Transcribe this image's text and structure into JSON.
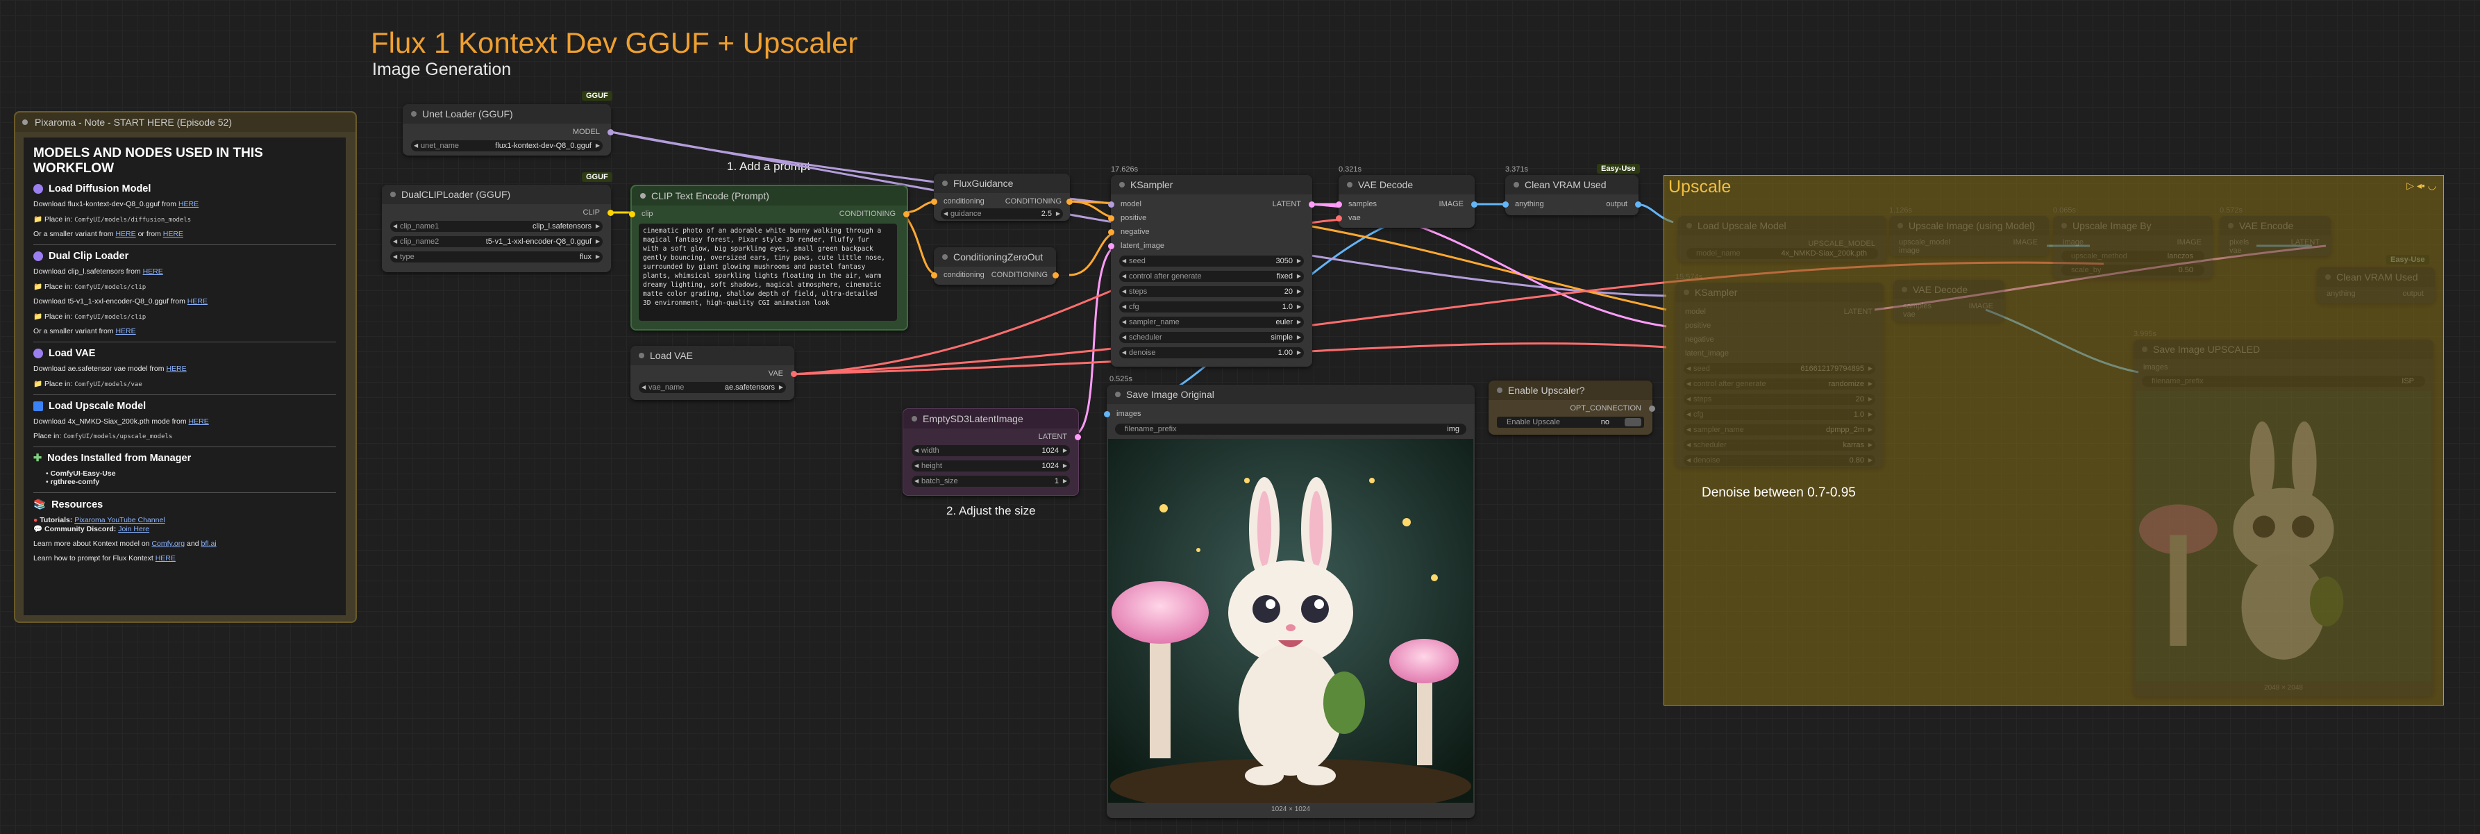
{
  "header": {
    "title": "Flux 1 Kontext Dev GGUF + Upscaler",
    "subtitle": "Image Generation"
  },
  "labels": {
    "step1": "1. Add a prompt",
    "step2": "2. Adjust the size",
    "denoise_tip": "Denoise between 0.7-0.95"
  },
  "note": {
    "title": "Pixaroma - Note - START HERE (Episode 52)",
    "heading": "MODELS AND NODES USED IN THIS WORKFLOW",
    "sec1_title": "Load Diffusion Model",
    "sec1_dl_prefix": "Download flux1-kontext-dev-Q8_0.gguf from",
    "sec1_place_prefix": "Place in:",
    "sec1_place_path": "ComfyUI/models/diffusion_models",
    "sec1_alt_prefix": "Or a smaller variant from",
    "sec1_alt_mid": "or from",
    "sec2_title": "Dual Clip Loader",
    "sec2_dl1_prefix": "Download clip_l.safetensors from",
    "sec2_place_prefix": "Place in:",
    "sec2_place_path": "ComfyUI/models/clip",
    "sec2_dl2_prefix": "Download t5-v1_1-xxl-encoder-Q8_0.gguf from",
    "sec2_place2_prefix": "Place in:",
    "sec2_place2_path": "ComfyUI/models/clip",
    "sec2_alt_prefix": "Or a smaller variant from",
    "sec3_title": "Load VAE",
    "sec3_dl_prefix": "Download ae.safetensor vae model from",
    "sec3_place_prefix": "Place in:",
    "sec3_place_path": "ComfyUI/models/vae",
    "sec4_title": "Load Upscale Model",
    "sec4_dl_prefix": "Download 4x_NMKD-Siax_200k.pth mode from",
    "sec4_place_prefix": "Place in:",
    "sec4_place_path": "ComfyUI/models/upscale_models",
    "sec5_title": "Nodes Installed from Manager",
    "sec5_item1": "ComfyUI-Easy-Use",
    "sec5_item2": "rgthree-comfy",
    "sec6_title": "Resources",
    "res_tutorials_prefix": "Tutorials:",
    "res_tutorials_link": "Pixaroma YouTube Channel",
    "res_discord_prefix": "Community Discord:",
    "res_discord_link": "Join Here",
    "res_learn_prefix": "Learn more about Kontext model on",
    "res_learn_link1": "Comfy.org",
    "res_learn_and": "and",
    "res_learn_link2": "bfl.ai",
    "res_prompt_prefix": "Learn how to prompt for Flux Kontext",
    "link_here": "HERE"
  },
  "nodes": {
    "unet": {
      "badge": "GGUF",
      "title": "Unet Loader (GGUF)",
      "out": "MODEL",
      "w_label": "unet_name",
      "w_value": "flux1-kontext-dev-Q8_0.gguf"
    },
    "dualclip": {
      "badge": "GGUF",
      "title": "DualCLIPLoader (GGUF)",
      "out": "CLIP",
      "w1_label": "clip_name1",
      "w1_value": "clip_l.safetensors",
      "w2_label": "clip_name2",
      "w2_value": "t5-v1_1-xxl-encoder-Q8_0.gguf",
      "w3_label": "type",
      "w3_value": "flux"
    },
    "clip_text": {
      "title": "CLIP Text Encode (Prompt)",
      "in": "clip",
      "out": "CONDITIONING",
      "prompt": "cinematic photo of an adorable white bunny walking through a magical fantasy forest, Pixar style 3D render, fluffy fur with a soft glow, big sparkling eyes, small green backpack gently bouncing, oversized ears, tiny paws, cute little nose, surrounded by giant glowing mushrooms and pastel fantasy plants, whimsical sparkling lights floating in the air, warm dreamy lighting, soft shadows, magical atmosphere, cinematic matte color grading, shallow depth of field, ultra-detailed 3D environment, high-quality CGI animation look"
    },
    "flux_guidance": {
      "title": "FluxGuidance",
      "in": "conditioning",
      "out": "CONDITIONING",
      "w_label": "guidance",
      "w_value": "2.5"
    },
    "cond_zero": {
      "title": "ConditioningZeroOut",
      "in": "conditioning",
      "out": "CONDITIONING"
    },
    "load_vae": {
      "title": "Load VAE",
      "out": "VAE",
      "w_label": "vae_name",
      "w_value": "ae.safetensors"
    },
    "empty_latent": {
      "title": "EmptySD3LatentImage",
      "out": "LATENT",
      "w1_label": "width",
      "w1_value": "1024",
      "w2_label": "height",
      "w2_value": "1024",
      "w3_label": "batch_size",
      "w3_value": "1"
    },
    "ksampler": {
      "timing": "17.626s",
      "title": "KSampler",
      "out": "LATENT",
      "in1": "model",
      "in2": "positive",
      "in3": "negative",
      "in4": "latent_image",
      "widgets": [
        {
          "label": "seed",
          "value": "3050"
        },
        {
          "label": "control after generate",
          "value": "fixed"
        },
        {
          "label": "steps",
          "value": "20"
        },
        {
          "label": "cfg",
          "value": "1.0"
        },
        {
          "label": "sampler_name",
          "value": "euler"
        },
        {
          "label": "scheduler",
          "value": "simple"
        },
        {
          "label": "denoise",
          "value": "1.00"
        }
      ]
    },
    "vae_decode": {
      "timing": "0.321s",
      "title": "VAE Decode",
      "in1": "samples",
      "in2": "vae",
      "out": "IMAGE"
    },
    "clean_vram": {
      "timing": "3.371s",
      "badge": "Easy-Use",
      "title": "Clean VRAM Used",
      "in": "anything",
      "out": "output"
    },
    "save_image": {
      "timing": "0.525s",
      "title": "Save Image Original",
      "in": "images",
      "w_label": "filename_prefix",
      "w_value": "img",
      "caption": "1024 × 1024"
    },
    "enable_upscaler": {
      "title": "Enable Upscaler?",
      "out": "OPT_CONNECTION",
      "w_label": "Enable Upscale",
      "w_value": "no"
    }
  },
  "upscale_group": {
    "title": "Upscale",
    "load_upscale": {
      "title": "Load Upscale Model",
      "out": "UPSCALE_MODEL",
      "w_label": "model_name",
      "w_value": "4x_NMKD-Siax_200k.pth"
    },
    "upscale_with_model": {
      "timing": "1.126s",
      "title": "Upscale Image (using Model)",
      "in1": "upscale_model",
      "in2": "image",
      "out": "IMAGE"
    },
    "upscale_by": {
      "timing": "0.065s",
      "title": "Upscale Image By",
      "in": "image",
      "out": "IMAGE",
      "w1_label": "upscale_method",
      "w1_value": "lanczos",
      "w2_label": "scale_by",
      "w2_value": "0.50"
    },
    "vae_encode": {
      "timing": "0.572s",
      "title": "VAE Encode",
      "in1": "pixels",
      "in2": "vae",
      "out": "LATENT"
    },
    "ksampler2": {
      "timing": "15.574s",
      "title": "KSampler",
      "out": "LATENT",
      "in1": "model",
      "in2": "positive",
      "in3": "negative",
      "in4": "latent_image",
      "widgets": [
        {
          "label": "seed",
          "value": "616612179794895"
        },
        {
          "label": "control after generate",
          "value": "randomize"
        },
        {
          "label": "steps",
          "value": "20"
        },
        {
          "label": "cfg",
          "value": "1.0"
        },
        {
          "label": "sampler_name",
          "value": "dpmpp_2m"
        },
        {
          "label": "scheduler",
          "value": "karras"
        },
        {
          "label": "denoise",
          "value": "0.80"
        }
      ]
    },
    "vae_decode2": {
      "title": "VAE Decode",
      "in1": "samples",
      "in2": "vae",
      "out": "IMAGE"
    },
    "clean_vram2": {
      "badge": "Easy-Use",
      "title": "Clean VRAM Used",
      "in": "anything",
      "out": "output"
    },
    "save_upscaled": {
      "timing": "3.995s",
      "title": "Save Image UPSCALED",
      "in": "images",
      "w_label": "filename_prefix",
      "w_value": "ISP",
      "caption": "2048 × 2048"
    }
  },
  "colors": {
    "accent_title": "#f0a030",
    "model_wire": "#b39ddb",
    "clip_wire": "#ffd500",
    "cond_wire": "#ffa931",
    "latent_wire": "#ff9cf9",
    "vae_wire": "#ff6e6e",
    "image_wire": "#64b5f6"
  }
}
